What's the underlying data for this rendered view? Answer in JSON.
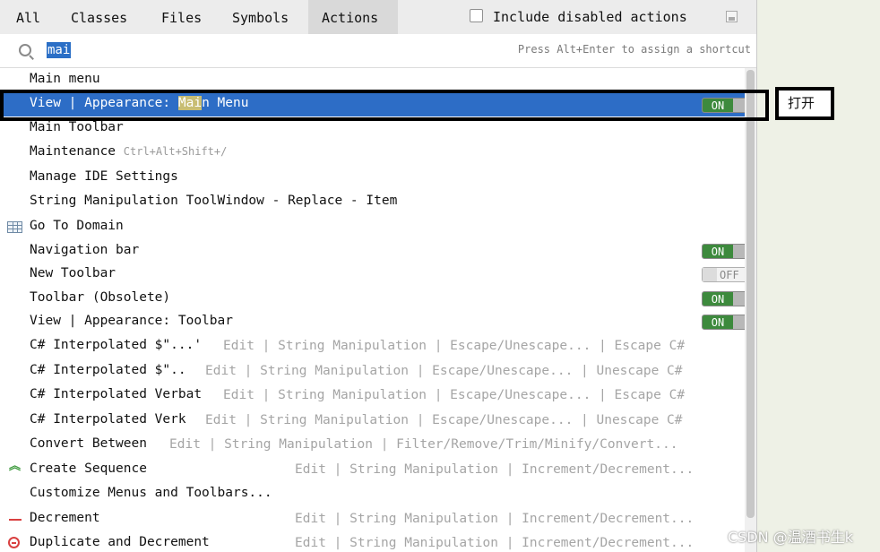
{
  "tabs": [
    "All",
    "Classes",
    "Files",
    "Symbols",
    "Actions"
  ],
  "active_tab": "Actions",
  "include_disabled_label": "Include disabled actions",
  "search": {
    "query": "mai",
    "hint": "Press Alt+Enter to assign a shortcut"
  },
  "rows": [
    {
      "label": "Main menu"
    },
    {
      "label_pre": "View | Appearance: ",
      "label_hl": "Mai",
      "label_post": "n Menu",
      "toggle": "ON"
    },
    {
      "label": "Main Toolbar"
    },
    {
      "label": "Maintenance",
      "shortcut": "Ctrl+Alt+Shift+/"
    },
    {
      "label": "Manage IDE Settings"
    },
    {
      "label": "String Manipulation ToolWindow - Replace - Item"
    },
    {
      "label": "Go To Domain",
      "icon": "table-icon"
    },
    {
      "label": "Navigation bar",
      "toggle": "ON"
    },
    {
      "label": "New Toolbar",
      "toggle": "OFF"
    },
    {
      "label": "Toolbar (Obsolete)",
      "toggle": "ON"
    },
    {
      "label": "View | Appearance: Toolbar",
      "toggle": "ON"
    },
    {
      "label": "C# Interpolated $\"...'",
      "path": "Edit | String Manipulation | Escape/Unescape... | Escape C#"
    },
    {
      "label": "C# Interpolated $\"..",
      "path": "Edit | String Manipulation | Escape/Unescape... | Unescape C#"
    },
    {
      "label": "C# Interpolated Verbat",
      "path": "Edit | String Manipulation | Escape/Unescape... | Escape C#"
    },
    {
      "label": "C# Interpolated Verk",
      "path": "Edit | String Manipulation | Escape/Unescape... | Unescape C#"
    },
    {
      "label": "Convert Between",
      "path": "Edit | String Manipulation | Filter/Remove/Trim/Minify/Convert..."
    },
    {
      "label": "Create Sequence",
      "path": "Edit | String Manipulation | Increment/Decrement...",
      "icon": "chevron-up-icon"
    },
    {
      "label": "Customize Menus and Toolbars..."
    },
    {
      "label": "Decrement",
      "path": "Edit | String Manipulation | Increment/Decrement...",
      "icon": "minus-icon"
    },
    {
      "label": "Duplicate and Decrement",
      "path": "Edit | String Manipulation | Increment/Decrement...",
      "icon": "minus-circle-icon"
    }
  ],
  "callout": {
    "text": "打开"
  },
  "watermark": "CSDN @温酒书生k",
  "colors": {
    "selection": "#2d6dc6",
    "toggle_on": "#3d8a3d",
    "search_highlight": "#c8bd73"
  }
}
